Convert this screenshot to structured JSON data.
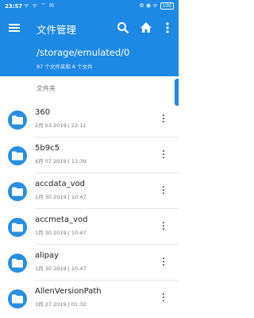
{
  "status": {
    "time": "23:57",
    "left_icons": "ᯤ ᯤ ⌔ ✉",
    "right_icons": "⚙ ◉ ᯤ",
    "battery": "100"
  },
  "appbar": {
    "title": "文件管理"
  },
  "path": {
    "location": "/storage/emulated/0",
    "summary": "87 个文件夹和 8 个文件"
  },
  "section": {
    "label": "文件夹"
  },
  "folders": [
    {
      "name": "360",
      "date": "2月 03 2019 | 22:11"
    },
    {
      "name": "5b9c5",
      "date": "4月 07 2019 | 11:39"
    },
    {
      "name": "accdata_vod",
      "date": "1月 30 2019 | 10:47"
    },
    {
      "name": "accmeta_vod",
      "date": "1月 30 2019 | 10:47"
    },
    {
      "name": "alipay",
      "date": "1月 30 2019 | 10:47"
    },
    {
      "name": "AllenVersionPath",
      "date": "3月 27 2019 | 01:32"
    }
  ],
  "colors": {
    "primary": "#1e88e5",
    "folder_icon": "#2a8ee0"
  }
}
